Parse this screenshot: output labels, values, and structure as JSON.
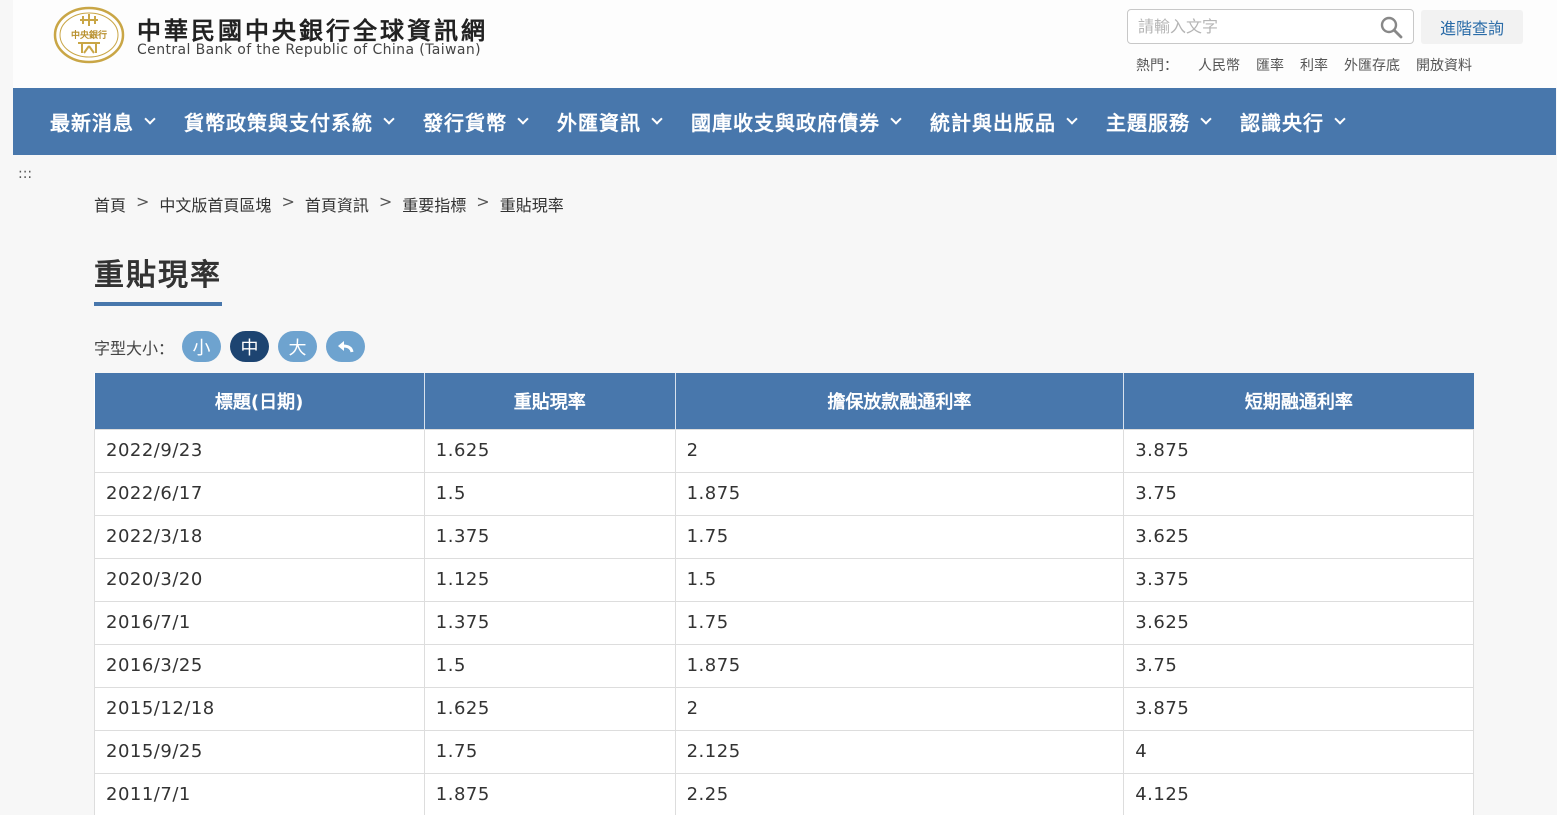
{
  "header": {
    "title": "中華民國中央銀行全球資訊網",
    "subtitle": "Central Bank of the Republic of China (Taiwan)",
    "logo_text": "中央銀行"
  },
  "search": {
    "placeholder": "請輸入文字",
    "advanced_label": "進階查詢"
  },
  "hot": {
    "label": "熱門：",
    "links": [
      "人民幣",
      "匯率",
      "利率",
      "外匯存底",
      "開放資料"
    ]
  },
  "nav": {
    "items": [
      "最新消息",
      "貨幣政策與支付系統",
      "發行貨幣",
      "外匯資訊",
      "國庫收支與政府債券",
      "統計與出版品",
      "主題服務",
      "認識央行"
    ]
  },
  "accesskey": ":::",
  "breadcrumb": [
    "首頁",
    "中文版首頁區塊",
    "首頁資訊",
    "重要指標",
    "重貼現率"
  ],
  "breadcrumb_sep": ">",
  "page_title": "重貼現率",
  "font_size": {
    "label": "字型大小：",
    "small": "小",
    "medium": "中",
    "large": "大"
  },
  "table": {
    "headers": [
      "標題(日期)",
      "重貼現率",
      "擔保放款融通利率",
      "短期融通利率"
    ],
    "rows": [
      [
        "2022/9/23",
        "1.625",
        "2",
        "3.875"
      ],
      [
        "2022/6/17",
        "1.5",
        "1.875",
        "3.75"
      ],
      [
        "2022/3/18",
        "1.375",
        "1.75",
        "3.625"
      ],
      [
        "2020/3/20",
        "1.125",
        "1.5",
        "3.375"
      ],
      [
        "2016/7/1",
        "1.375",
        "1.75",
        "3.625"
      ],
      [
        "2016/3/25",
        "1.5",
        "1.875",
        "3.75"
      ],
      [
        "2015/12/18",
        "1.625",
        "2",
        "3.875"
      ],
      [
        "2015/9/25",
        "1.75",
        "2.125",
        "4"
      ],
      [
        "2011/7/1",
        "1.875",
        "2.25",
        "4.125"
      ]
    ]
  },
  "colors": {
    "primary": "#4877ac",
    "active_button": "#1d4471",
    "light_button": "#6ea3cf",
    "logo_gold": "#c9a646"
  }
}
